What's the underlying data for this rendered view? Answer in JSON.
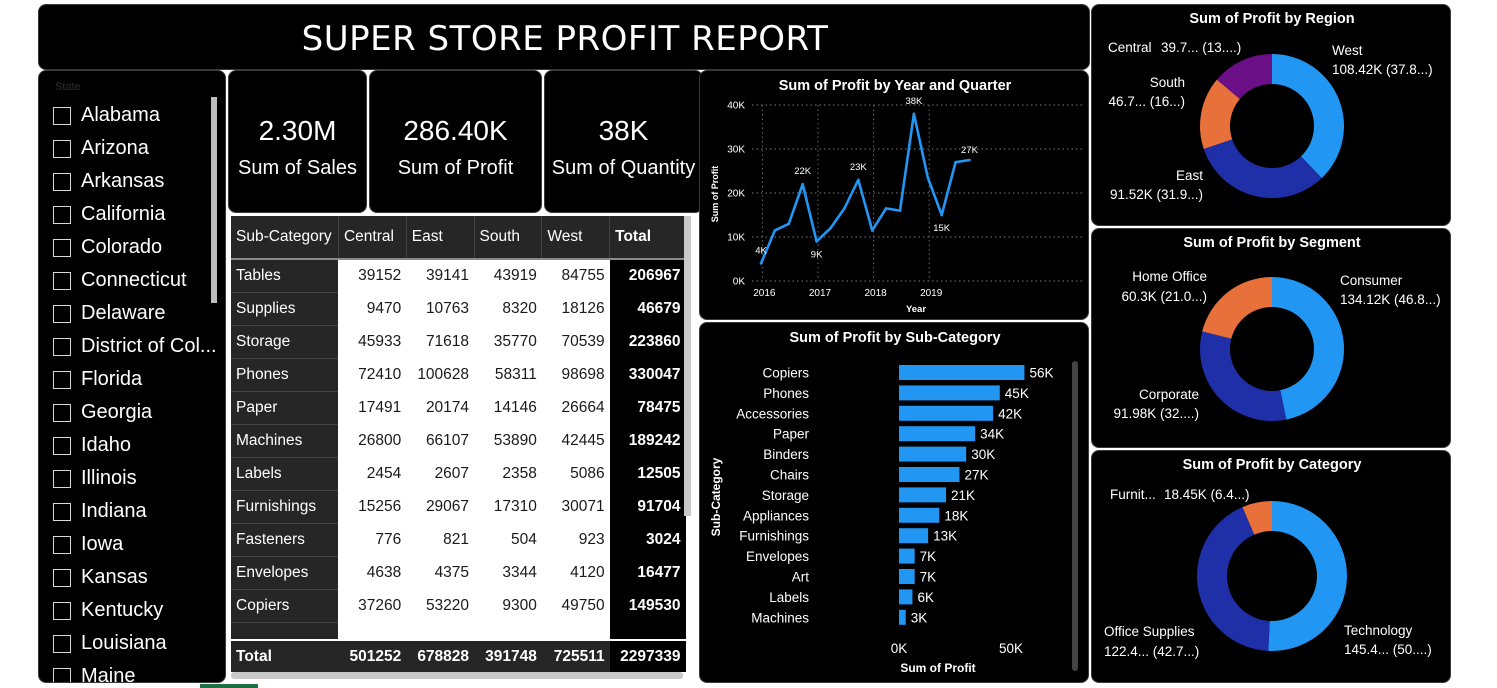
{
  "header": {
    "title": "SUPER STORE PROFIT REPORT"
  },
  "slicer": {
    "label": "State",
    "items": [
      "Alabama",
      "Arizona",
      "Arkansas",
      "California",
      "Colorado",
      "Connecticut",
      "Delaware",
      "District of Col...",
      "Florida",
      "Georgia",
      "Idaho",
      "Illinois",
      "Indiana",
      "Iowa",
      "Kansas",
      "Kentucky",
      "Louisiana",
      "Maine"
    ]
  },
  "kpis": [
    {
      "value": "2.30M",
      "label": "Sum of Sales"
    },
    {
      "value": "286.40K",
      "label": "Sum of Profit"
    },
    {
      "value": "38K",
      "label": "Sum of Quantity"
    }
  ],
  "matrix": {
    "headers": [
      "Sub-Category",
      "Central",
      "East",
      "South",
      "West",
      "Total"
    ],
    "rows": [
      [
        "Tables",
        "39152",
        "39141",
        "43919",
        "84755",
        "206967"
      ],
      [
        "Supplies",
        "9470",
        "10763",
        "8320",
        "18126",
        "46679"
      ],
      [
        "Storage",
        "45933",
        "71618",
        "35770",
        "70539",
        "223860"
      ],
      [
        "Phones",
        "72410",
        "100628",
        "58311",
        "98698",
        "330047"
      ],
      [
        "Paper",
        "17491",
        "20174",
        "14146",
        "26664",
        "78475"
      ],
      [
        "Machines",
        "26800",
        "66107",
        "53890",
        "42445",
        "189242"
      ],
      [
        "Labels",
        "2454",
        "2607",
        "2358",
        "5086",
        "12505"
      ],
      [
        "Furnishings",
        "15256",
        "29067",
        "17310",
        "30071",
        "91704"
      ],
      [
        "Fasteners",
        "776",
        "821",
        "504",
        "923",
        "3024"
      ],
      [
        "Envelopes",
        "4638",
        "4375",
        "3344",
        "4120",
        "16477"
      ],
      [
        "Copiers",
        "37260",
        "53220",
        "9300",
        "49750",
        "149530"
      ]
    ],
    "total": [
      "Total",
      "501252",
      "678828",
      "391748",
      "725511",
      "2297339"
    ]
  },
  "chart_data": [
    {
      "type": "line",
      "title": "Sum of Profit by Year and Quarter",
      "xlabel": "Year",
      "ylabel": "Sum of Profit",
      "x": [
        "2016 Q1",
        "2016 Q2",
        "2016 Q3",
        "2016 Q4",
        "2017 Q1",
        "2017 Q2",
        "2017 Q3",
        "2017 Q4",
        "2018 Q1",
        "2018 Q2",
        "2018 Q3",
        "2018 Q4",
        "2019 Q1",
        "2019 Q2",
        "2019 Q3",
        "2019 Q4"
      ],
      "x_ticks": [
        "2016",
        "2017",
        "2018",
        "2019"
      ],
      "values": [
        4000,
        11500,
        13000,
        22000,
        9000,
        12000,
        16500,
        23000,
        11500,
        16500,
        16000,
        38000,
        23500,
        15000,
        27000,
        27500
      ],
      "data_labels": [
        {
          "x": "2016 Q1",
          "text": "4K"
        },
        {
          "x": "2016 Q4",
          "text": "22K"
        },
        {
          "x": "2017 Q1",
          "text": "9K"
        },
        {
          "x": "2017 Q4",
          "text": "23K"
        },
        {
          "x": "2018 Q4",
          "text": "38K"
        },
        {
          "x": "2019 Q2",
          "text": "15K"
        },
        {
          "x": "2019 Q4",
          "text": "27K"
        }
      ],
      "y_ticks": [
        "0K",
        "10K",
        "20K",
        "30K",
        "40K"
      ],
      "ylim": [
        0,
        40000
      ],
      "grid": true,
      "color": "#2196F3"
    },
    {
      "type": "bar",
      "orientation": "horizontal",
      "title": "Sum of Profit by Sub-Category",
      "xlabel": "Sum of Profit",
      "ylabel": "Sub-Category",
      "categories": [
        "Copiers",
        "Phones",
        "Accessories",
        "Paper",
        "Binders",
        "Chairs",
        "Storage",
        "Appliances",
        "Furnishings",
        "Envelopes",
        "Art",
        "Labels",
        "Machines"
      ],
      "values": [
        56000,
        45000,
        42000,
        34000,
        30000,
        27000,
        21000,
        18000,
        13000,
        7000,
        7000,
        6000,
        3000
      ],
      "data_labels": [
        "56K",
        "45K",
        "42K",
        "34K",
        "30K",
        "27K",
        "21K",
        "18K",
        "13K",
        "7K",
        "7K",
        "6K",
        "3K"
      ],
      "x_ticks": [
        "0K",
        "50K"
      ],
      "xlim": [
        0,
        100000
      ],
      "color": "#2196F3"
    },
    {
      "type": "pie",
      "donut": true,
      "title": "Sum of Profit by Region",
      "slices": [
        {
          "name": "West",
          "value": 108.42,
          "label": "108.42K (37.8...)",
          "color": "#2196F3"
        },
        {
          "name": "East",
          "value": 91.52,
          "label": "91.52K (31.9...)",
          "color": "#1E2FA8"
        },
        {
          "name": "South",
          "value": 46.7,
          "label": "46.7... (16...)",
          "color": "#E8703A"
        },
        {
          "name": "Central",
          "value": 39.7,
          "label": "39.7... (13....)",
          "color": "#6B0F86"
        }
      ]
    },
    {
      "type": "pie",
      "donut": true,
      "title": "Sum of Profit by Segment",
      "slices": [
        {
          "name": "Consumer",
          "value": 134.12,
          "label": "134.12K (46.8...)",
          "color": "#2196F3"
        },
        {
          "name": "Corporate",
          "value": 91.98,
          "label": "91.98K (32....)",
          "color": "#1E2FA8"
        },
        {
          "name": "Home Office",
          "value": 60.3,
          "label": "60.3K (21.0...)",
          "color": "#E8703A"
        }
      ]
    },
    {
      "type": "pie",
      "donut": true,
      "title": "Sum of Profit by Category",
      "slices": [
        {
          "name": "Technology",
          "value": 145.4,
          "label": "145.4... (50....)",
          "color": "#2196F3"
        },
        {
          "name": "Office Supplies",
          "value": 122.4,
          "label": "122.4... (42.7...)",
          "color": "#1E2FA8"
        },
        {
          "name": "Furnit...",
          "value": 18.45,
          "label": "18.45K (6.4...)",
          "color": "#E8703A"
        }
      ]
    }
  ]
}
